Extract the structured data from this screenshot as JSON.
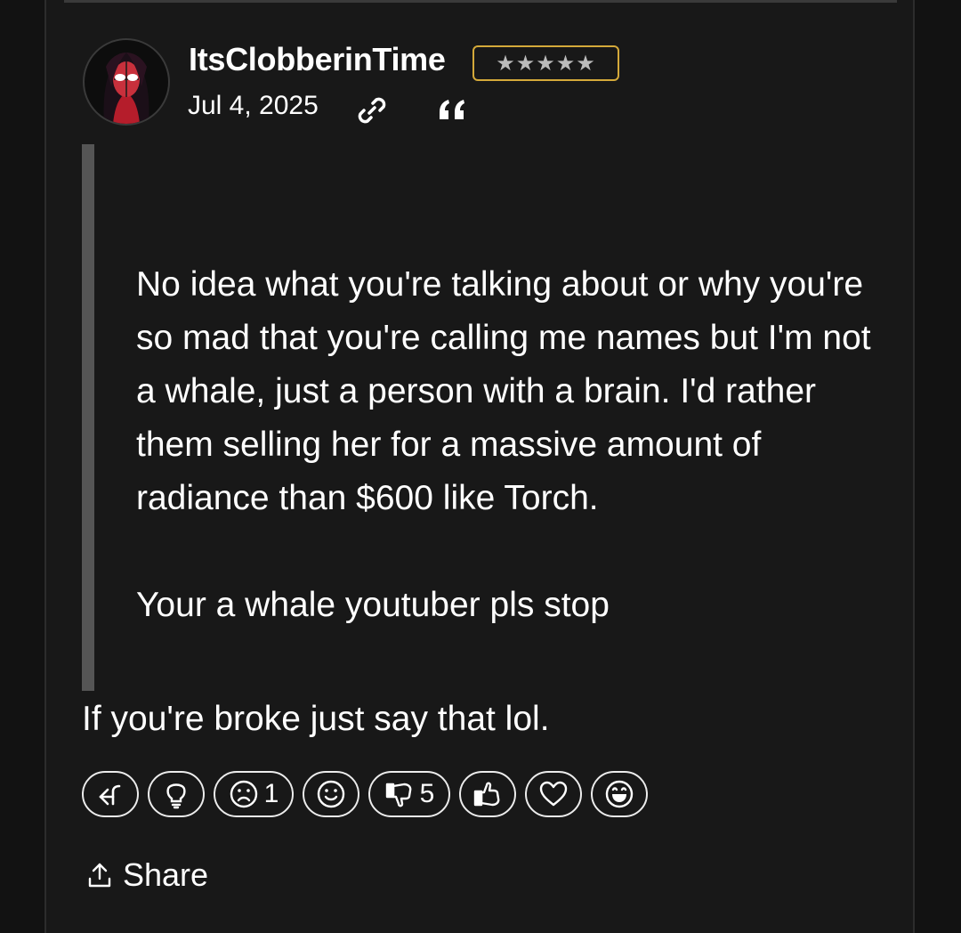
{
  "post": {
    "username": "ItsClobberinTime",
    "rank_stars": "★★★★★",
    "date": "Jul 4, 2025",
    "quote_paragraphs": [
      "No idea what you're talking about or why you're so mad that you're calling me names but I'm not a whale, just a person with a brain. I'd rather them selling her for a massive amount of radiance than $600 like Torch.",
      "Your a whale youtuber pls stop"
    ],
    "reply": "If you're broke just say that lol."
  },
  "reactions": {
    "frown_count": "1",
    "thumbs_down_count": "5"
  },
  "actions": {
    "share_label": "Share"
  },
  "colors": {
    "background": "#181818",
    "badge_border": "#d4a93a",
    "quote_bar": "#555555"
  },
  "icons": [
    "avatar",
    "link-icon",
    "quote-icon",
    "reply-icon",
    "lightbulb-icon",
    "frown-icon",
    "smile-icon",
    "thumbs-down-icon",
    "thumbs-up-icon",
    "heart-icon",
    "laugh-icon",
    "share-icon"
  ]
}
